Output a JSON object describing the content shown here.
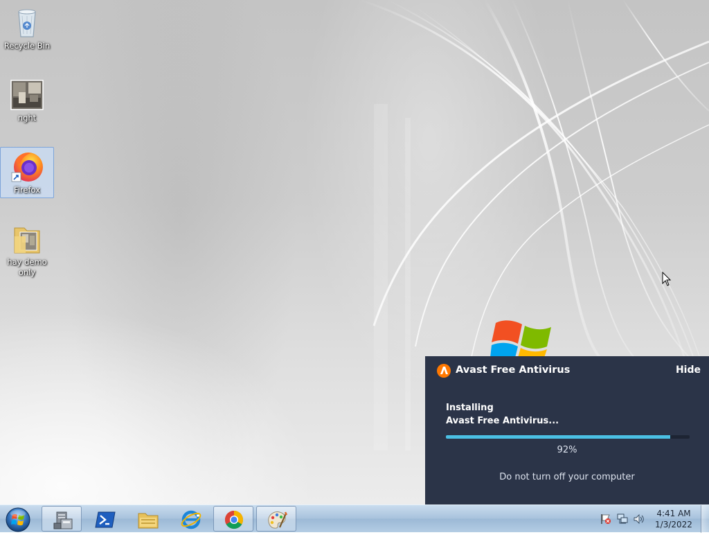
{
  "desktop": {
    "icons": [
      {
        "label": "Recycle Bin"
      },
      {
        "label": "nght"
      },
      {
        "label": "Firefox"
      },
      {
        "label": "hay demo only"
      }
    ]
  },
  "avast": {
    "title": "Avast Free Antivirus",
    "hide_label": "Hide",
    "status_line1": "Installing",
    "status_line2": "Avast Free Antivirus...",
    "progress": 0.92,
    "percent_label": "92%",
    "warning": "Do not turn off your computer",
    "colors": {
      "panel": "#2b3448",
      "accent": "#ff7800",
      "progress": "#4bc0e4"
    }
  },
  "taskbar": {
    "start_icon": "windows-start-orb",
    "pinned": [
      {
        "name": "server-manager-icon",
        "open": true
      },
      {
        "name": "powershell-icon",
        "open": false
      },
      {
        "name": "file-explorer-icon",
        "open": false
      },
      {
        "name": "internet-explorer-icon",
        "open": false
      },
      {
        "name": "chrome-icon",
        "open": true
      },
      {
        "name": "paint-icon",
        "open": true
      }
    ],
    "tray": {
      "icons": [
        "action-center-flag-icon",
        "network-icon",
        "volume-icon"
      ],
      "time": "4:41 AM",
      "date": "1/3/2022"
    }
  }
}
